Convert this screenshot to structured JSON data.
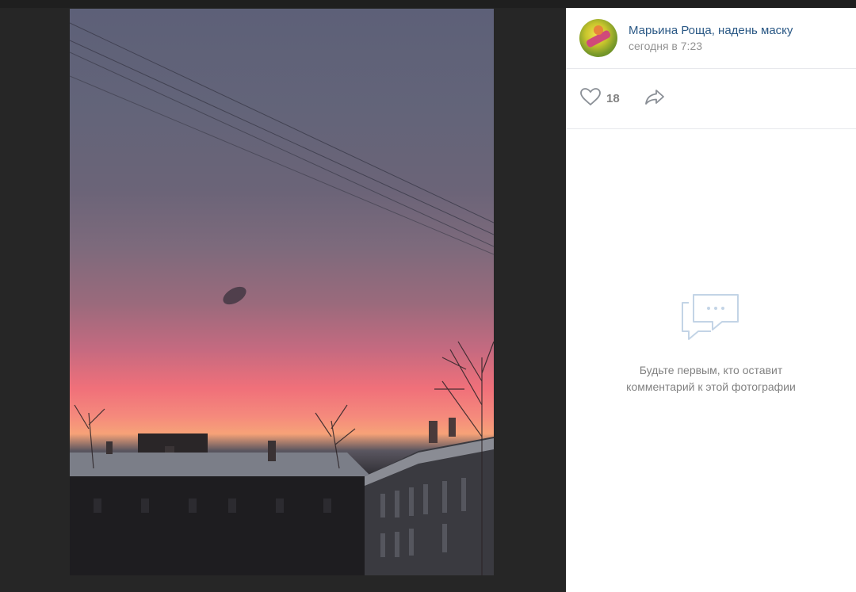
{
  "post": {
    "author": "Марьина Роща, надень маску",
    "time": "сегодня в 7:23"
  },
  "actions": {
    "likes": "18"
  },
  "comments": {
    "empty_text": "Будьте первым, кто оставит комментарий к этой фотографии"
  },
  "colors": {
    "link": "#2a5885",
    "muted": "#939393",
    "viewer_bg": "#262626"
  },
  "icons": [
    "heart-icon",
    "share-arrow-icon",
    "comments-icon"
  ]
}
